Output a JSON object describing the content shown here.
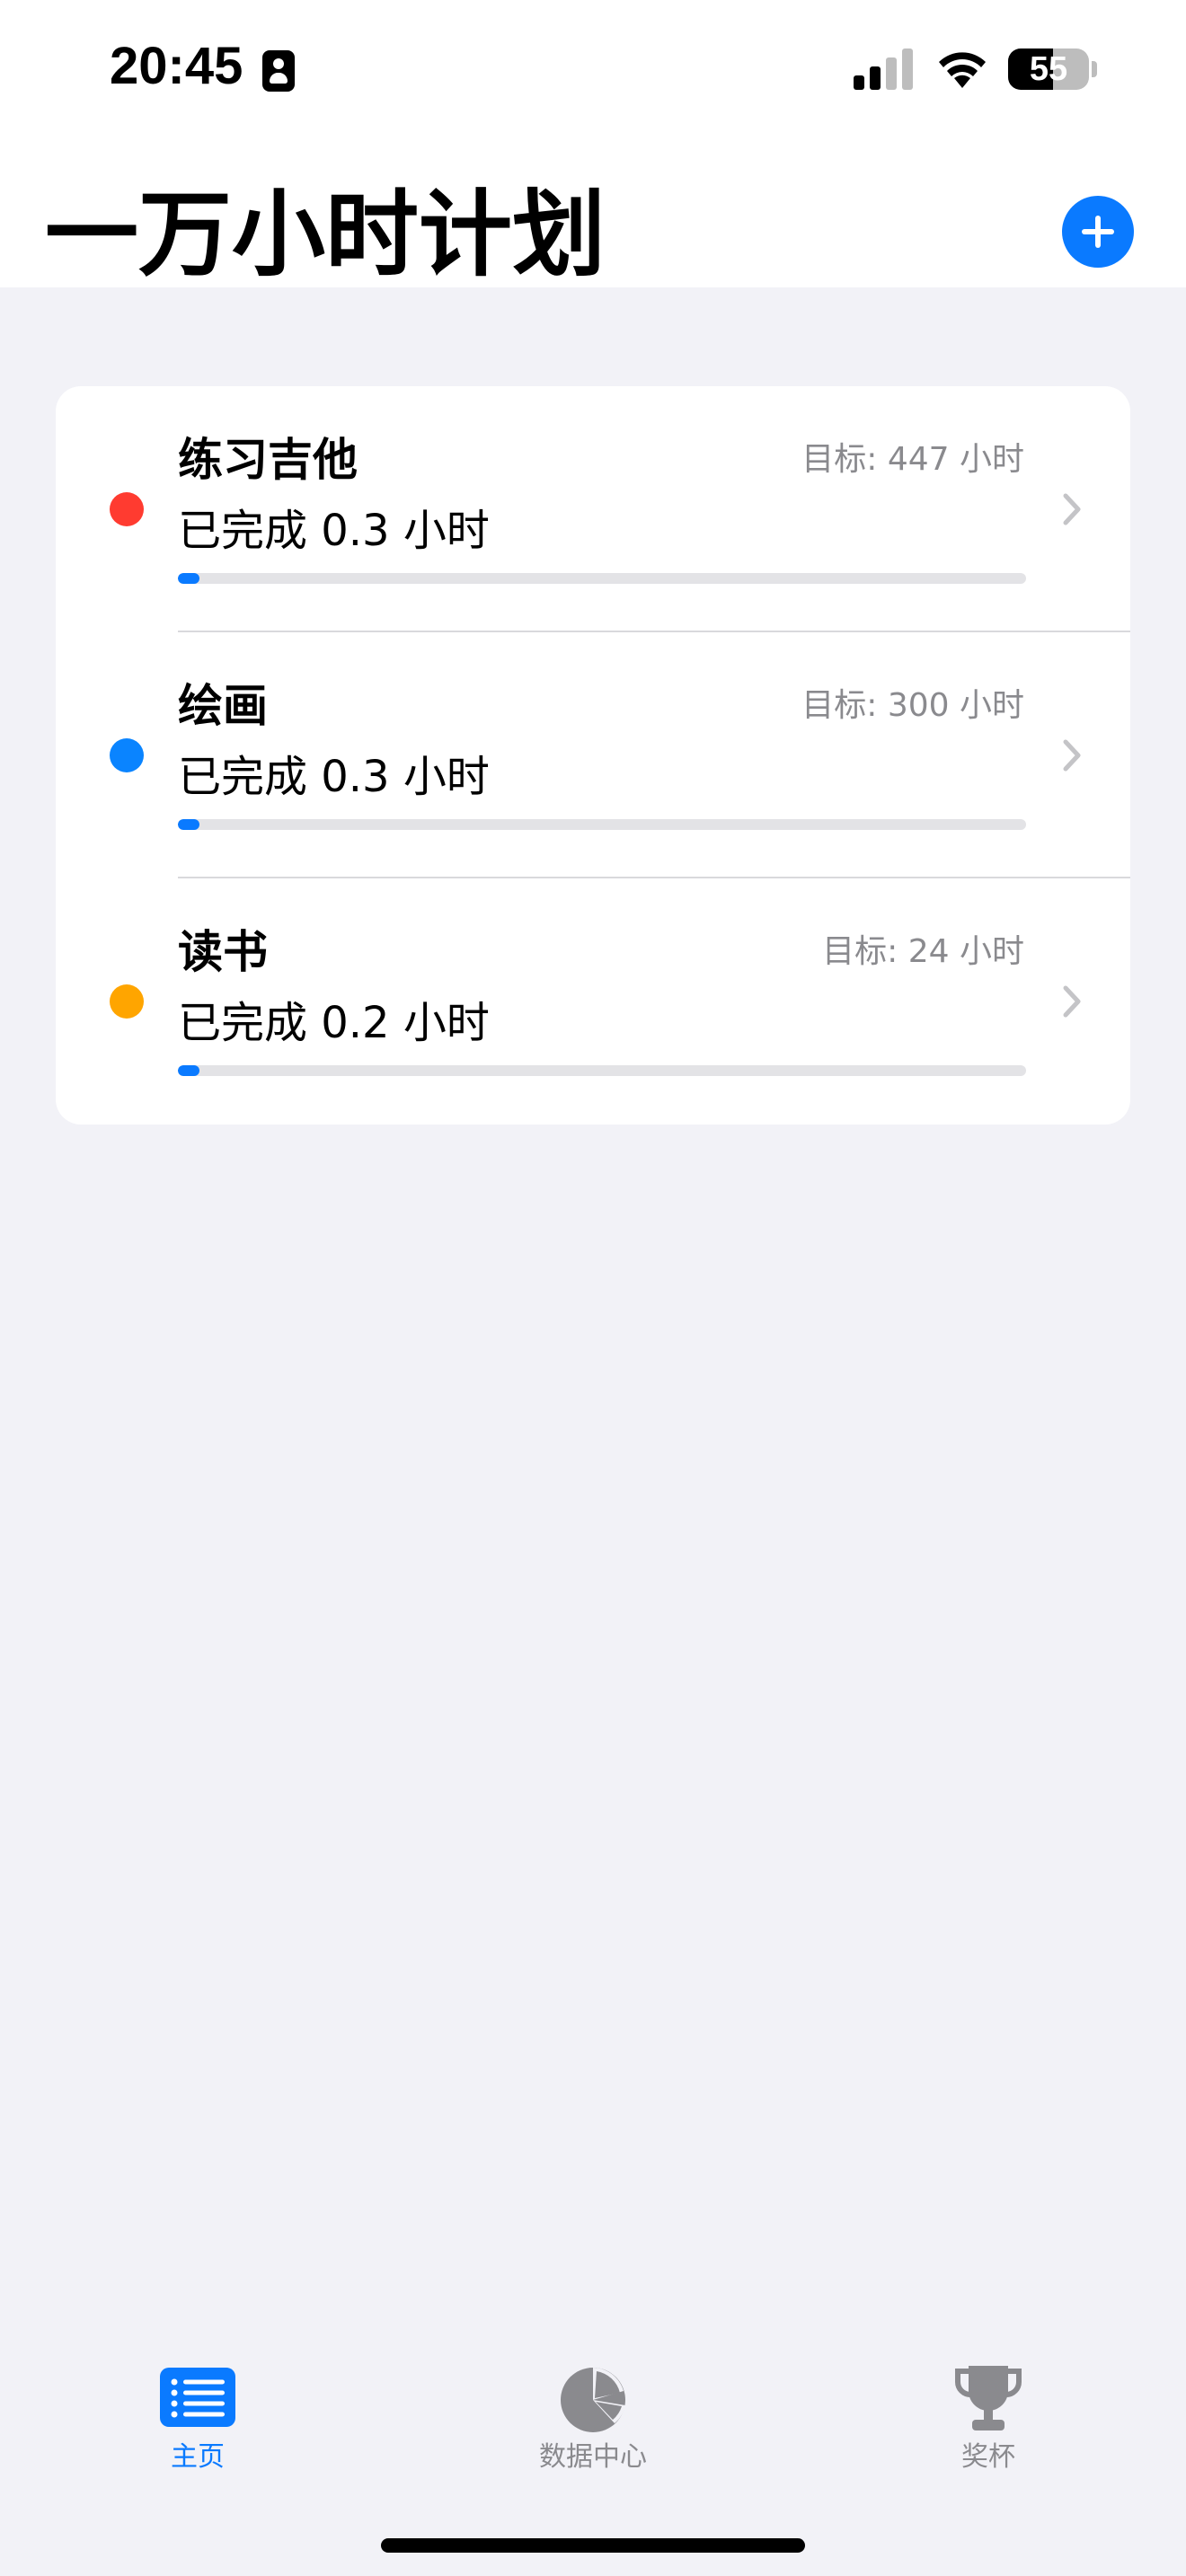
{
  "status_bar": {
    "time": "20:45",
    "battery": "55",
    "battery_level": 0.55
  },
  "header": {
    "title": "一万小时计划",
    "add_button_icon": "plus-circle-icon"
  },
  "plans": [
    {
      "name": "练习吉他",
      "target": "目标: 447 小时",
      "completed": "已完成 0.3 小时",
      "progress": 0.0007,
      "color": "#FF3B30"
    },
    {
      "name": "绘画",
      "target": "目标: 300 小时",
      "completed": "已完成 0.3 小时",
      "progress": 0.001,
      "color": "#0A84FF"
    },
    {
      "name": "读书",
      "target": "目标: 24 小时",
      "completed": "已完成 0.2 小时",
      "progress": 0.0083,
      "color": "#FFA500"
    }
  ],
  "tabs": [
    {
      "label": "主页",
      "icon": "list-icon",
      "active": true
    },
    {
      "label": "数据中心",
      "icon": "pie-chart-icon",
      "active": false
    },
    {
      "label": "奖杯",
      "icon": "trophy-icon",
      "active": false
    }
  ],
  "colors": {
    "accent": "#0A7AFF",
    "inactive": "#8A8A8E",
    "background": "#F2F2F7"
  }
}
